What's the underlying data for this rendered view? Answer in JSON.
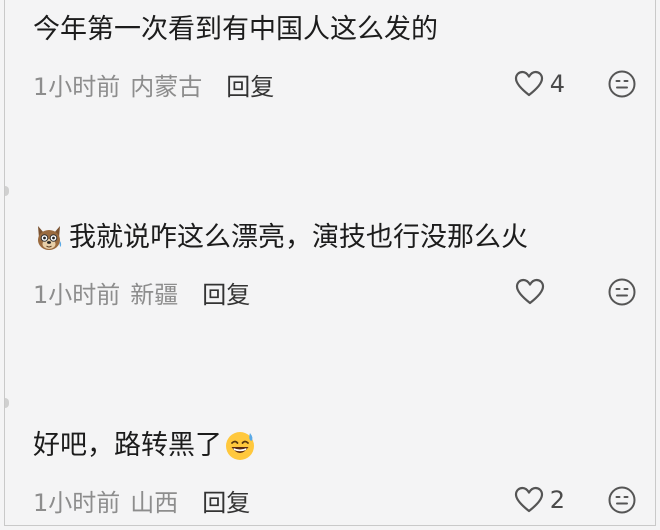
{
  "comments": [
    {
      "text": "今年第一次看到有中国人这么发的",
      "time": "1小时前",
      "location": "内蒙古",
      "reply_label": "回复",
      "like_count": "4",
      "leading_emoji": null,
      "trailing_emoji": null
    },
    {
      "text": "我就说咋这么漂亮，演技也行没那么火",
      "time": "1小时前",
      "location": "新疆",
      "reply_label": "回复",
      "like_count": "",
      "leading_emoji": "dog-face-emoji",
      "trailing_emoji": null
    },
    {
      "text": "好吧，路转黑了",
      "time": "1小时前",
      "location": "山西",
      "reply_label": "回复",
      "like_count": "2",
      "leading_emoji": null,
      "trailing_emoji": "sweat-smile-emoji"
    }
  ],
  "icons": {
    "like": "heart-outline-icon",
    "reaction": "smiley-face-icon"
  },
  "colors": {
    "background": "#f4f4f5",
    "text": "#1c1c1c",
    "meta": "#8d8d8d",
    "icon": "#555555"
  }
}
